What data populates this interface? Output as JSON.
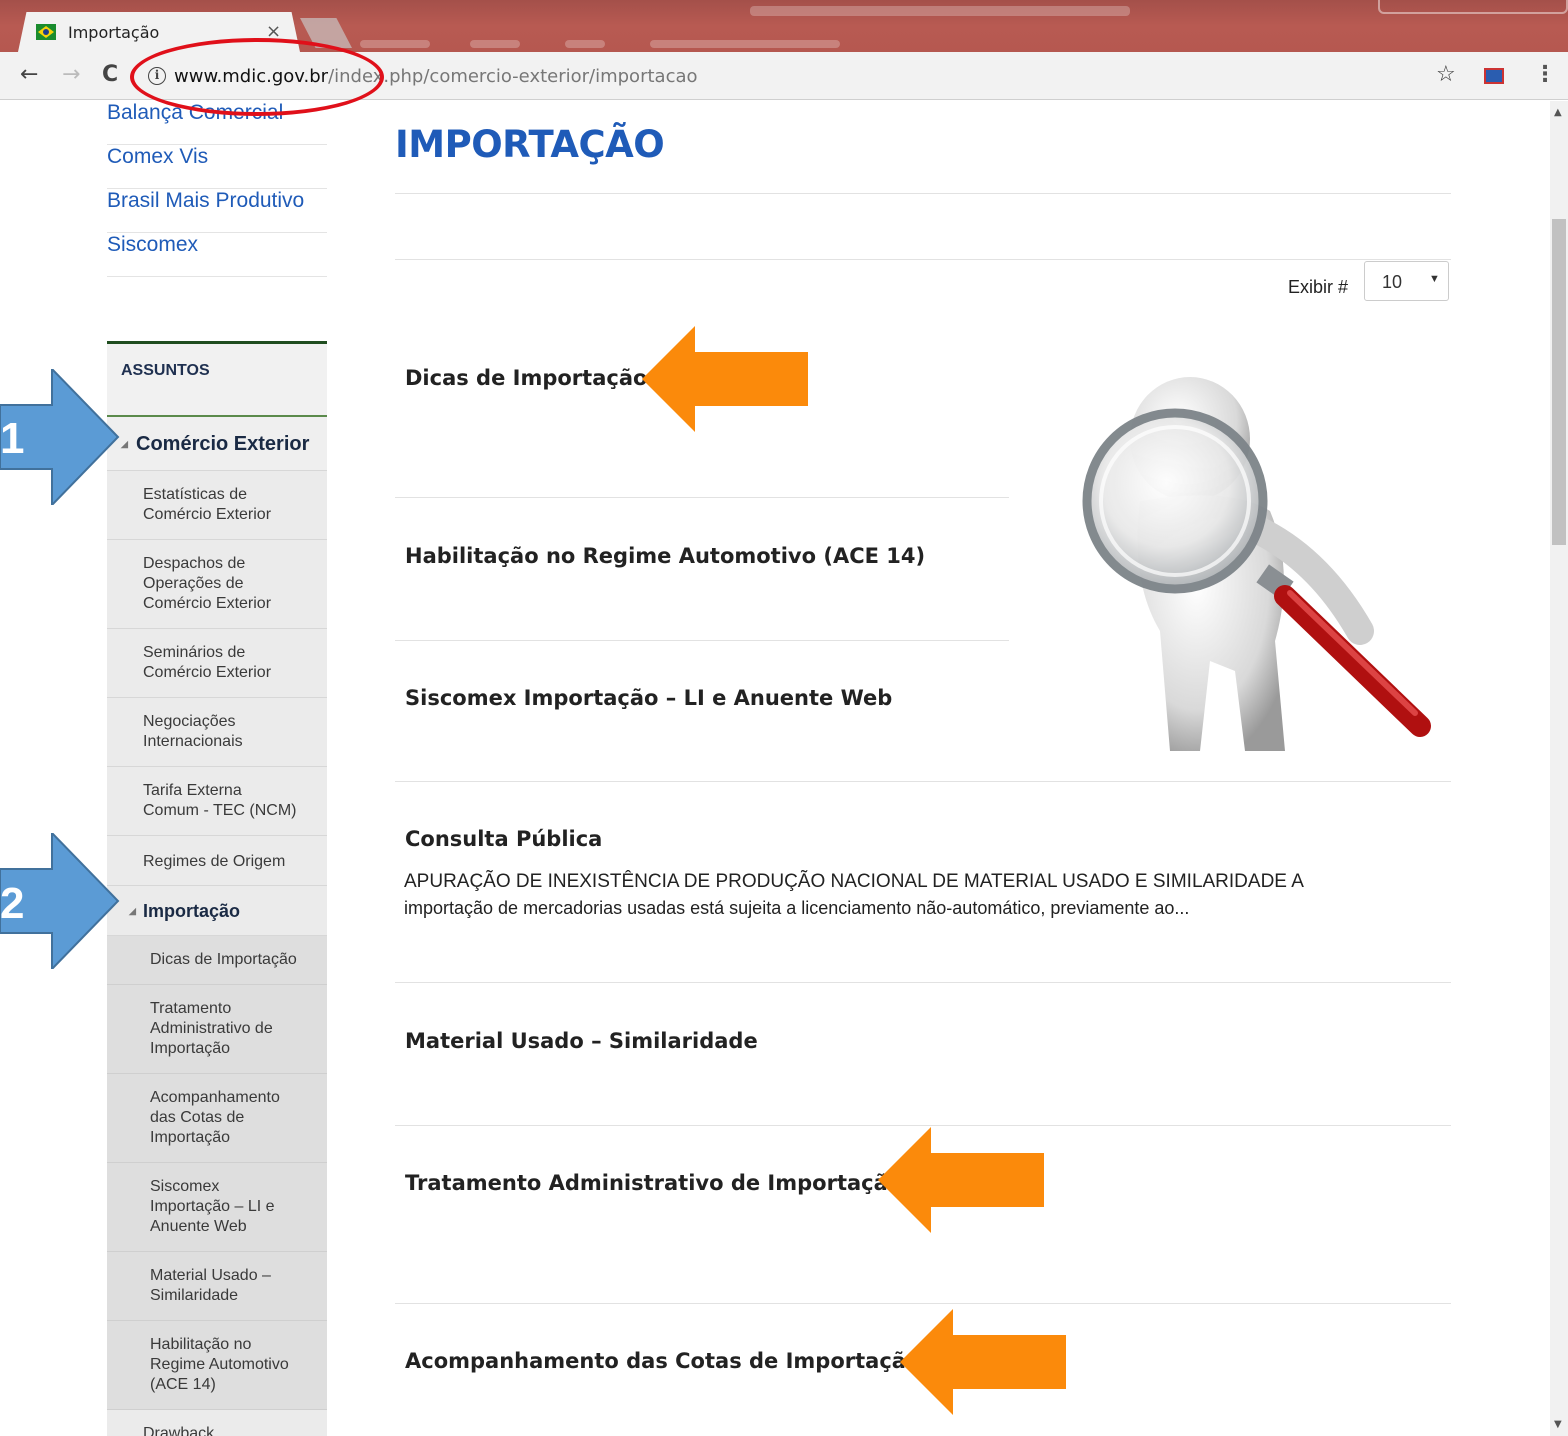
{
  "browser": {
    "tab_title": "Importação",
    "tab_close": "×",
    "url_host": "www.mdic.gov.br",
    "url_path": "/index.php/comercio-exterior/importacao",
    "back": "←",
    "forward": "→",
    "reload": "C",
    "info": "i",
    "star": "☆",
    "menu": "⋮"
  },
  "sidebar": {
    "top_links": [
      "Balança Comercial",
      "Comex Vis",
      "Brasil Mais Produtivo",
      "Siscomex"
    ],
    "section_label": "ASSUNTOS",
    "group": "Comércio Exterior",
    "items": [
      "Estatísticas de Comércio Exterior",
      "Despachos de Operações de Comércio Exterior",
      "Seminários de Comércio Exterior",
      "Negociações Internacionais",
      "Tarifa Externa Comum - TEC (NCM)",
      "Regimes de Origem"
    ],
    "subgroup": "Importação",
    "subitems": [
      "Dicas de Importação",
      "Tratamento Administrativo de Importação",
      "Acompanhamento das Cotas de Importação",
      "Siscomex Importação – LI e Anuente Web",
      "Material Usado – Similaridade",
      "Habilitação no Regime Automotivo (ACE 14)"
    ],
    "next_item": "Drawback"
  },
  "main": {
    "title": "IMPORTAÇÃO",
    "exibir_label": "Exibir #",
    "exibir_value": "10",
    "articles": [
      {
        "title": "Dicas de Importação"
      },
      {
        "title": "Habilitação no Regime Automotivo (ACE 14)"
      },
      {
        "title": "Siscomex Importação – LI e Anuente Web"
      },
      {
        "title": "Consulta Pública",
        "body_line1": "APURAÇÃO DE INEXISTÊNCIA DE PRODUÇÃO NACIONAL DE MATERIAL USADO E SIMILARIDADE A",
        "body_line2": "importação de mercadorias usadas está sujeita a licenciamento não-automático, previamente ao..."
      },
      {
        "title": "Material Usado – Similaridade"
      },
      {
        "title": "Tratamento Administrativo de Importação"
      },
      {
        "title": "Acompanhamento das Cotas de Importação"
      }
    ]
  },
  "annotations": {
    "step1": "1",
    "step2": "2",
    "arrow_color": "#fb8a0b",
    "blue_arrow_color": "#5b9bd5",
    "ellipse_color": "#e0101a"
  }
}
